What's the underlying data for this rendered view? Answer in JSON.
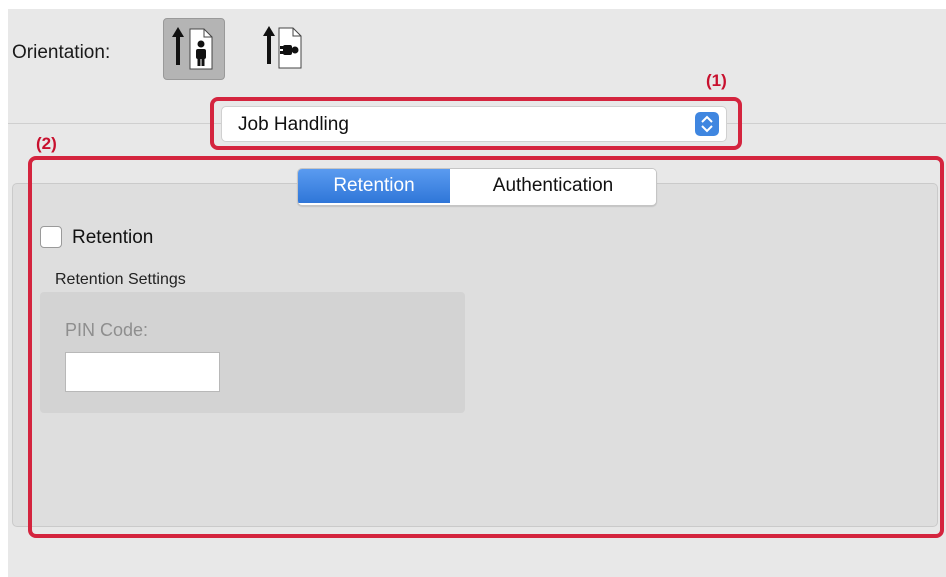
{
  "orientation": {
    "label": "Orientation:",
    "options": [
      "portrait",
      "landscape"
    ],
    "selected": "portrait"
  },
  "popup": {
    "value": "Job Handling"
  },
  "callouts": {
    "one": "(1)",
    "two": "(2)",
    "color": "#d4243e"
  },
  "tabs": {
    "items": [
      "Retention",
      "Authentication"
    ],
    "active": "Retention"
  },
  "retention": {
    "checkbox_label": "Retention",
    "checked": false,
    "settings_label": "Retention Settings",
    "pin_label": "PIN Code:",
    "pin_value": ""
  },
  "colors": {
    "accent": "#3f86e0",
    "panel": "#e8e8e8"
  }
}
